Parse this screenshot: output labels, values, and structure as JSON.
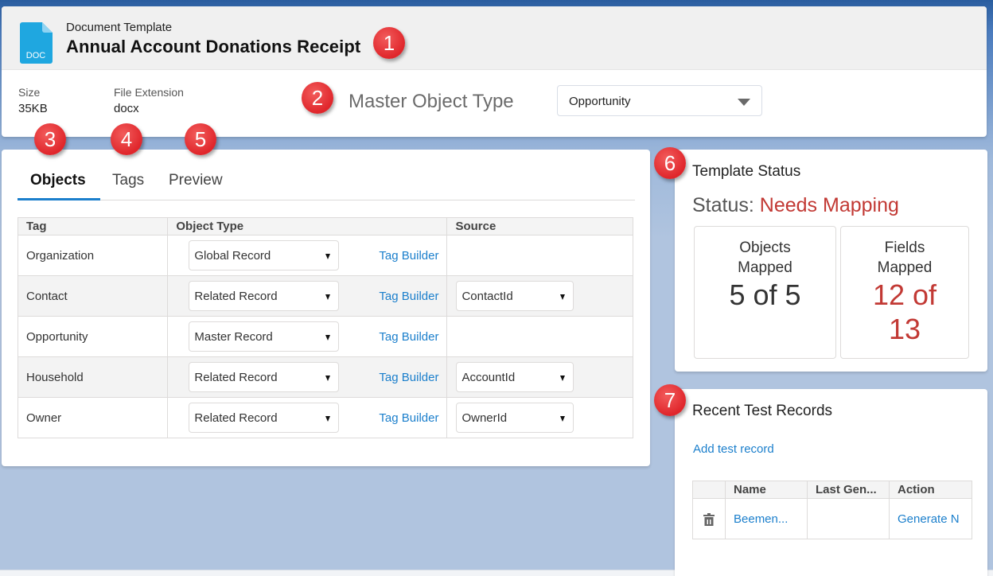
{
  "header": {
    "icon_label": "DOC",
    "icon_color": "#1fa7e0",
    "subtitle": "Document Template",
    "title": "Annual Account Donations Receipt",
    "size_label": "Size",
    "size_value": "35KB",
    "ext_label": "File Extension",
    "ext_value": "docx",
    "master_label": "Master Object Type",
    "master_value": "Opportunity"
  },
  "badges": [
    "1",
    "2",
    "3",
    "4",
    "5",
    "6",
    "7"
  ],
  "tabs": [
    {
      "label": "Objects",
      "active": true
    },
    {
      "label": "Tags",
      "active": false
    },
    {
      "label": "Preview",
      "active": false
    }
  ],
  "objects_table": {
    "headers": [
      "Tag",
      "Object Type",
      "Source"
    ],
    "rows": [
      {
        "tag": "Organization",
        "type": "Global Record",
        "link": "Tag Builder",
        "source": ""
      },
      {
        "tag": "Contact",
        "type": "Related Record",
        "link": "Tag Builder",
        "source": "ContactId"
      },
      {
        "tag": "Opportunity",
        "type": "Master Record",
        "link": "Tag Builder",
        "source": ""
      },
      {
        "tag": "Household",
        "type": "Related Record",
        "link": "Tag Builder",
        "source": "AccountId"
      },
      {
        "tag": "Owner",
        "type": "Related Record",
        "link": "Tag Builder",
        "source": "OwnerId"
      }
    ]
  },
  "template_status": {
    "title": "Template Status",
    "status_prefix": "Status:",
    "status_value": "Needs Mapping",
    "status_color": "#c23934",
    "objects_label_1": "Objects",
    "objects_label_2": "Mapped",
    "objects_value": "5 of 5",
    "fields_label_1": "Fields",
    "fields_label_2": "Mapped",
    "fields_value_1": "12 of",
    "fields_value_2": "13"
  },
  "recent_records": {
    "title": "Recent Test Records",
    "add_link": "Add test record",
    "headers": [
      "",
      "Name",
      "Last Gen...",
      "Action"
    ],
    "rows": [
      {
        "icon": "trash-icon",
        "name": "Beemen...",
        "last_generated": "",
        "action": "Generate N"
      }
    ]
  }
}
